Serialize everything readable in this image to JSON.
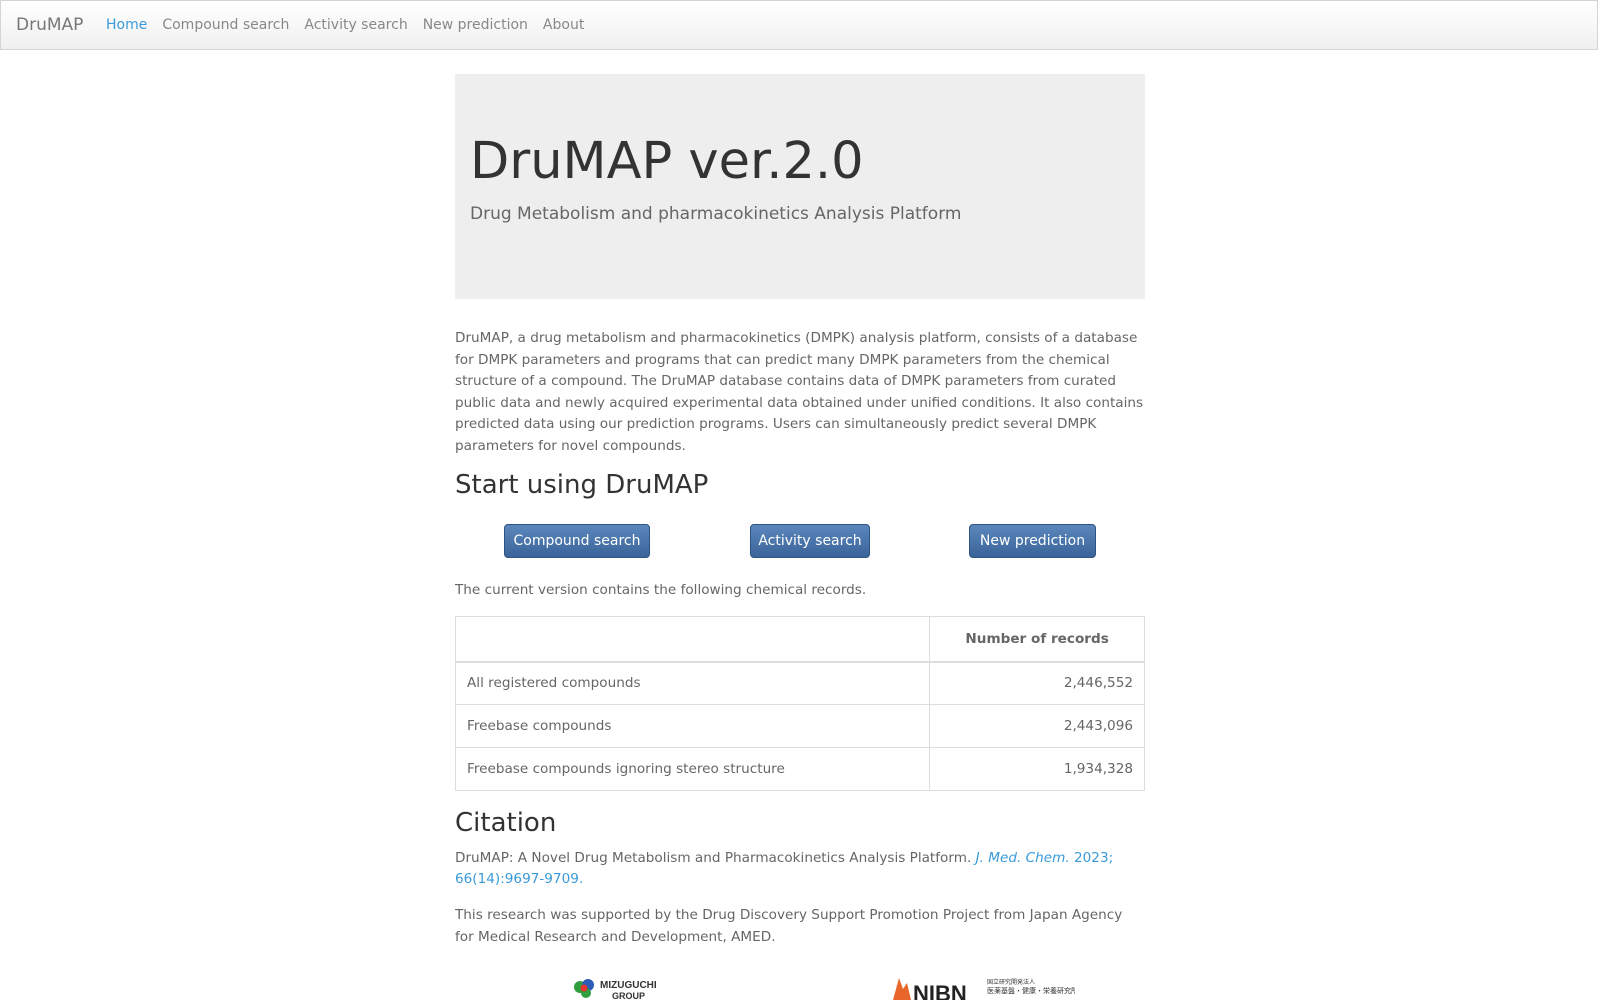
{
  "navbar": {
    "brand": "DruMAP",
    "items": [
      {
        "label": "Home",
        "active": true
      },
      {
        "label": "Compound search",
        "active": false
      },
      {
        "label": "Activity search",
        "active": false
      },
      {
        "label": "New prediction",
        "active": false
      },
      {
        "label": "About",
        "active": false
      }
    ]
  },
  "jumbotron": {
    "title": "DruMAP ver.2.0",
    "subtitle": "Drug Metabolism and pharmacokinetics Analysis Platform"
  },
  "intro": "DruMAP, a drug metabolism and pharmacokinetics (DMPK) analysis platform, consists of a database for DMPK parameters and programs that can predict many DMPK parameters from the chemical structure of a compound. The DruMAP database contains data of DMPK parameters from curated public data and newly acquired experimental data obtained under unified conditions. It also contains predicted data using our prediction programs. Users can simultaneously predict several DMPK parameters for novel compounds.",
  "start": {
    "title": "Start using DruMAP",
    "buttons": {
      "compound_search": "Compound search",
      "activity_search": "Activity search",
      "new_prediction": "New prediction"
    }
  },
  "records": {
    "note": "The current version contains the following chemical records.",
    "header": [
      "",
      "Number of records"
    ],
    "rows": [
      {
        "label": "All registered compounds",
        "value": "2,446,552"
      },
      {
        "label": "Freebase compounds",
        "value": "2,443,096"
      },
      {
        "label": "Freebase compounds ignoring stereo structure",
        "value": "1,934,328"
      }
    ]
  },
  "citation": {
    "title": "Citation",
    "text": "DruMAP: A Novel Drug Metabolism and Pharmacokinetics Analysis Platform.",
    "journal": "J. Med. Chem.",
    "ref": "2023; 66(14):9697-9709."
  },
  "support": "This research was supported by the Drug Discovery Support Promotion Project from Japan Agency for Medical Research and Development, AMED.",
  "logos": {
    "mizuguchi": {
      "line1": "MIZUGUCHI",
      "line2": "GROUP"
    },
    "nibn": {
      "mark": "NIBN",
      "line1": "国立研究開発法人",
      "line2": "医薬基盤・健康・栄養研究所"
    }
  },
  "colors": {
    "link": "#3a9ad9",
    "button": "#3a6499",
    "jumbotron_bg": "#eeeeee"
  }
}
